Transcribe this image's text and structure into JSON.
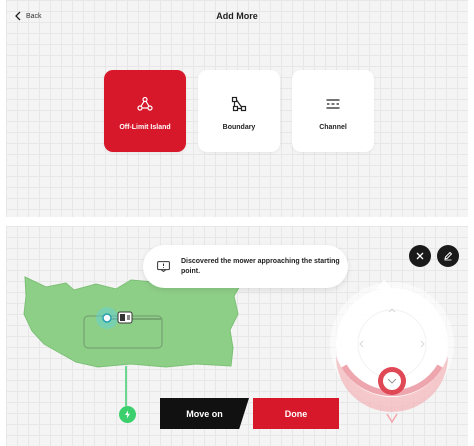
{
  "header": {
    "back_label": "Back",
    "title": "Add More"
  },
  "options": [
    {
      "label": "Off-Limit Island",
      "icon": "off-limit-island-icon",
      "selected": true
    },
    {
      "label": "Boundary",
      "icon": "boundary-icon",
      "selected": false
    },
    {
      "label": "Channel",
      "icon": "channel-icon",
      "selected": false
    }
  ],
  "notification": {
    "icon": "message-icon",
    "text_line1": "Discovered the mower approaching the starting",
    "text_line2": "point."
  },
  "map": {
    "lawn_color": "#8ecf88",
    "icons": [
      "close-icon",
      "edit-icon",
      "power-icon",
      "mower-icon"
    ]
  },
  "actions": {
    "move_on_label": "Move on",
    "done_label": "Done"
  },
  "colors": {
    "accent": "#d7172a",
    "dark": "#111111",
    "green": "#3ccf6e"
  }
}
